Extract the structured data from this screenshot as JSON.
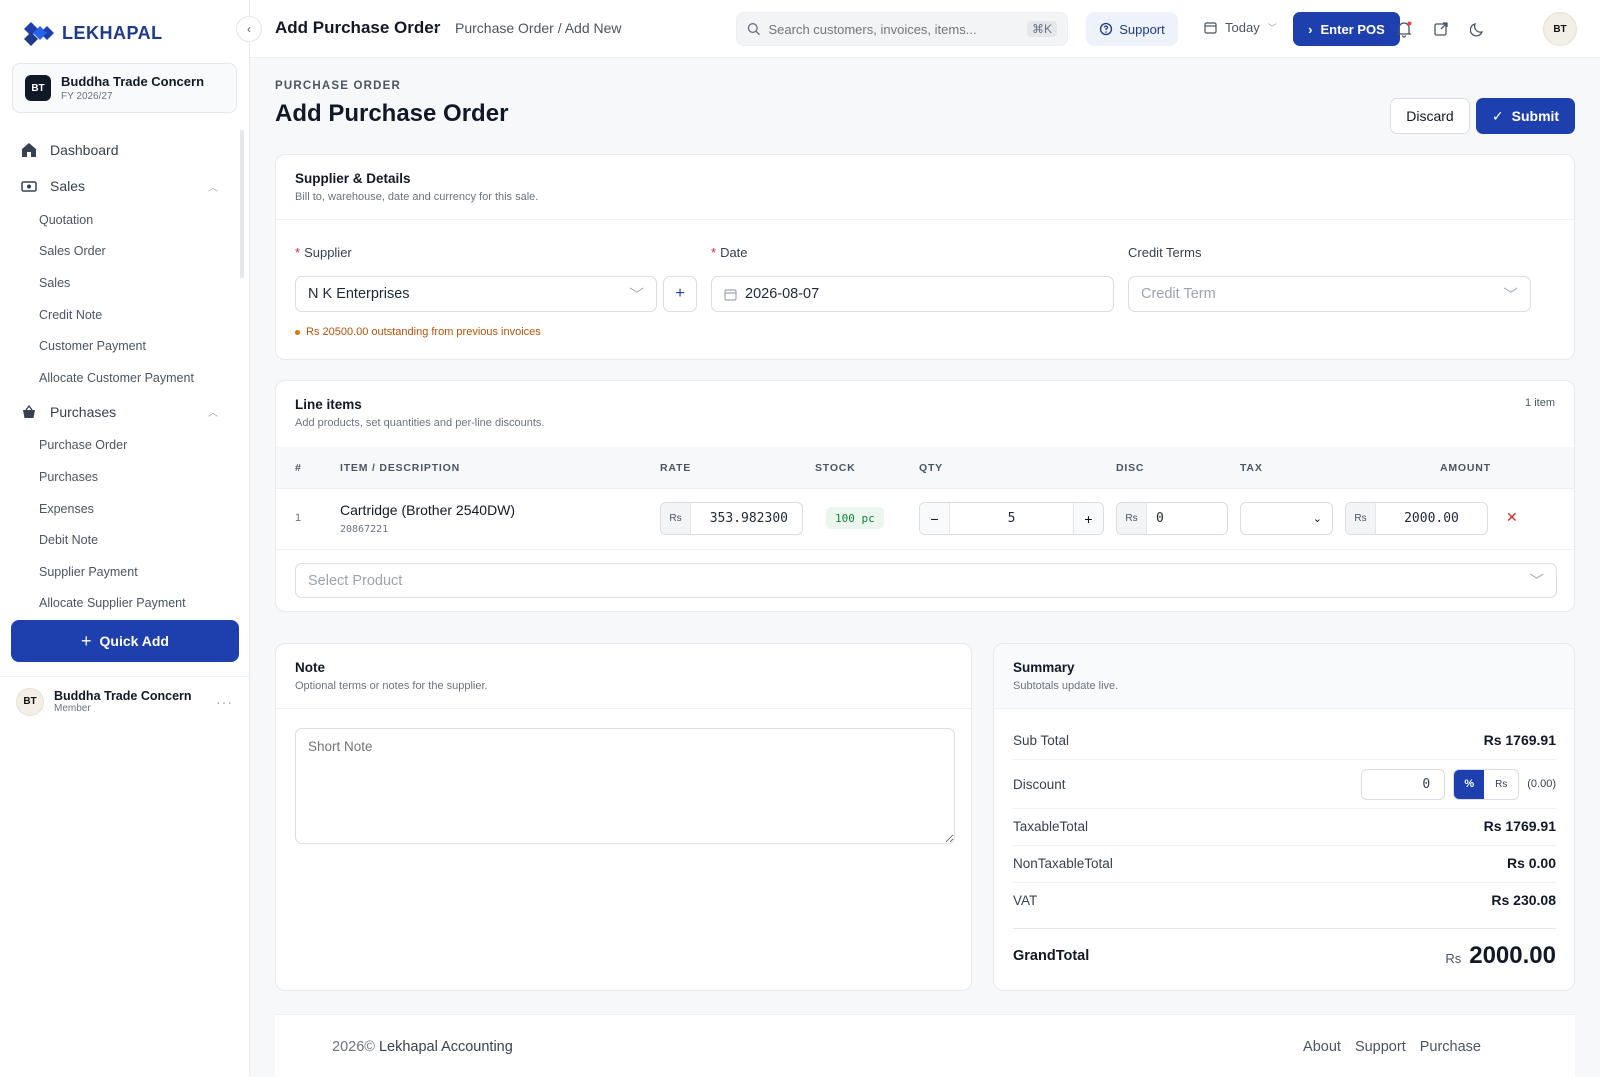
{
  "brand": {
    "name": "LEKHAPAL",
    "accent": "#1e40af"
  },
  "org": {
    "initials": "BT",
    "name": "Buddha Trade Concern",
    "fy": "FY 2026/27"
  },
  "nav": {
    "dashboard": "Dashboard",
    "sales": {
      "label": "Sales",
      "items": [
        "Quotation",
        "Sales Order",
        "Sales",
        "Credit Note",
        "Customer Payment",
        "Allocate Customer Payment"
      ]
    },
    "purchases": {
      "label": "Purchases",
      "items": [
        "Purchase Order",
        "Purchases",
        "Expenses",
        "Debit Note",
        "Supplier Payment",
        "Allocate Supplier Payment"
      ]
    }
  },
  "quick_add": "Quick Add",
  "user": {
    "initials": "BT",
    "name": "Buddha Trade Concern",
    "role": "Member"
  },
  "topbar": {
    "title": "Add Purchase Order",
    "breadcrumb": "Purchase Order / Add New",
    "search_placeholder": "Search customers, invoices, items...",
    "search_shortcut": "⌘K",
    "support": "Support",
    "date_filter": "Today",
    "enter_pos": "Enter POS",
    "avatar": "BT"
  },
  "page": {
    "eyebrow": "PURCHASE ORDER",
    "title": "Add Purchase Order",
    "discard": "Discard",
    "submit": "Submit"
  },
  "supplier_card": {
    "title": "Supplier & Details",
    "subtitle": "Bill to, warehouse, date and currency for this sale.",
    "supplier_label": "Supplier",
    "supplier_value": "N K Enterprises",
    "date_label": "Date",
    "date_value": "2026-08-07",
    "credit_terms_label": "Credit Terms",
    "credit_terms_placeholder": "Credit Term",
    "outstanding": "Rs 20500.00 outstanding from previous invoices"
  },
  "line_items": {
    "title": "Line items",
    "subtitle": "Add products, set quantities and per-line discounts.",
    "count": "1 item",
    "headers": {
      "num": "#",
      "item": "ITEM / DESCRIPTION",
      "rate": "RATE",
      "stock": "STOCK",
      "qty": "QTY",
      "disc": "DISC",
      "tax": "TAX",
      "amount": "AMOUNT"
    },
    "rows": [
      {
        "num": "1",
        "name": "Cartridge (Brother 2540DW)",
        "code": "20867221",
        "currency": "Rs",
        "rate": "353.982300",
        "stock": "100 pc",
        "qty": "5",
        "disc": "0",
        "amount": "2000.00"
      }
    ],
    "select_product_placeholder": "Select Product"
  },
  "note_card": {
    "title": "Note",
    "subtitle": "Optional terms or notes for the supplier.",
    "placeholder": "Short Note"
  },
  "summary": {
    "title": "Summary",
    "subtitle": "Subtotals update live.",
    "sub_total_label": "Sub Total",
    "sub_total": "Rs 1769.91",
    "discount_label": "Discount",
    "discount_value": "0",
    "discount_pct": "%",
    "discount_rs": "Rs",
    "discount_amount": "(0.00)",
    "taxable_label": "TaxableTotal",
    "taxable": "Rs 1769.91",
    "nontaxable_label": "NonTaxableTotal",
    "nontaxable": "Rs 0.00",
    "vat_label": "VAT",
    "vat": "Rs 230.08",
    "grand_label": "GrandTotal",
    "grand_currency": "Rs",
    "grand_total": "2000.00"
  },
  "footer": {
    "year": "2026©",
    "company": "Lekhapal Accounting",
    "links": [
      "About",
      "Support",
      "Purchase"
    ]
  }
}
